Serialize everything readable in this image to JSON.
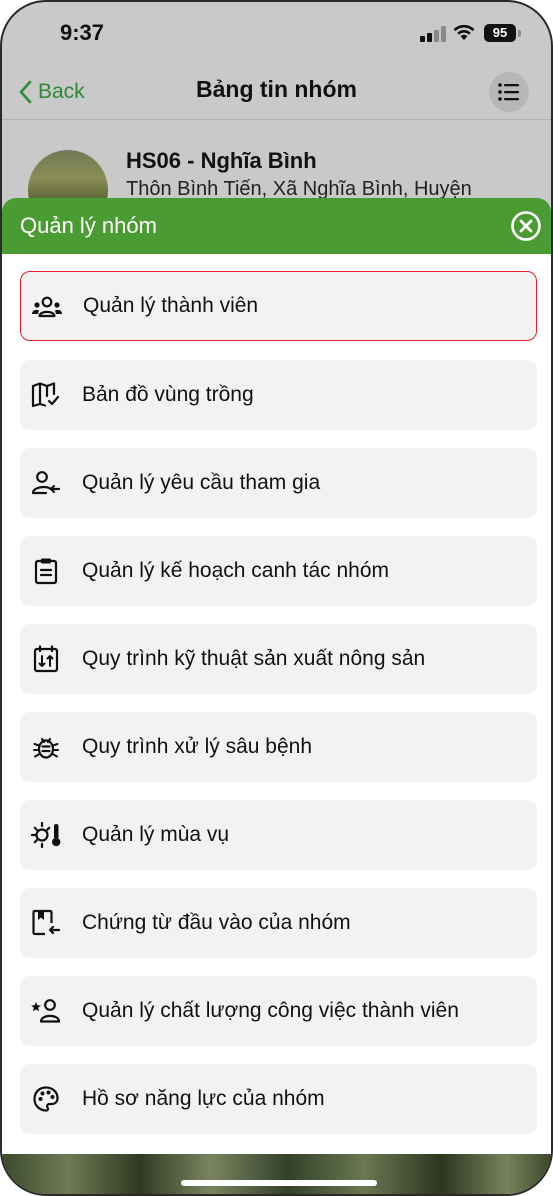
{
  "status_bar": {
    "time": "9:37",
    "battery": "95"
  },
  "nav": {
    "back_label": "Back",
    "title": "Bảng tin nhóm"
  },
  "group": {
    "name": "HS06 - Nghĩa Bình",
    "address": "Thôn Bình Tiến, Xã Nghĩa Bình, Huyện"
  },
  "sheet": {
    "title": "Quản lý nhóm",
    "items": [
      {
        "label": "Quản lý thành viên",
        "icon": "group-icon",
        "selected": true
      },
      {
        "label": "Bản đồ vùng trồng",
        "icon": "map-icon"
      },
      {
        "label": "Quản lý yêu cầu tham gia",
        "icon": "person-request-icon"
      },
      {
        "label": "Quản lý kế hoạch canh tác nhóm",
        "icon": "clipboard-icon"
      },
      {
        "label": "Quy trình kỹ thuật sản xuất nông sản",
        "icon": "calendar-swap-icon"
      },
      {
        "label": "Quy trình xử lý sâu bệnh",
        "icon": "bug-icon"
      },
      {
        "label": "Quản lý mùa vụ",
        "icon": "weather-thermometer-icon"
      },
      {
        "label": "Chứng từ đầu vào của nhóm",
        "icon": "document-return-icon"
      },
      {
        "label": "Quản lý chất lượng công việc thành viên",
        "icon": "person-star-icon"
      },
      {
        "label": "Hồ sơ năng lực của nhóm",
        "icon": "palette-icon"
      }
    ]
  },
  "colors": {
    "accent": "#4b9b33",
    "back": "#2e8b35",
    "selected_border": "#e0202a"
  }
}
